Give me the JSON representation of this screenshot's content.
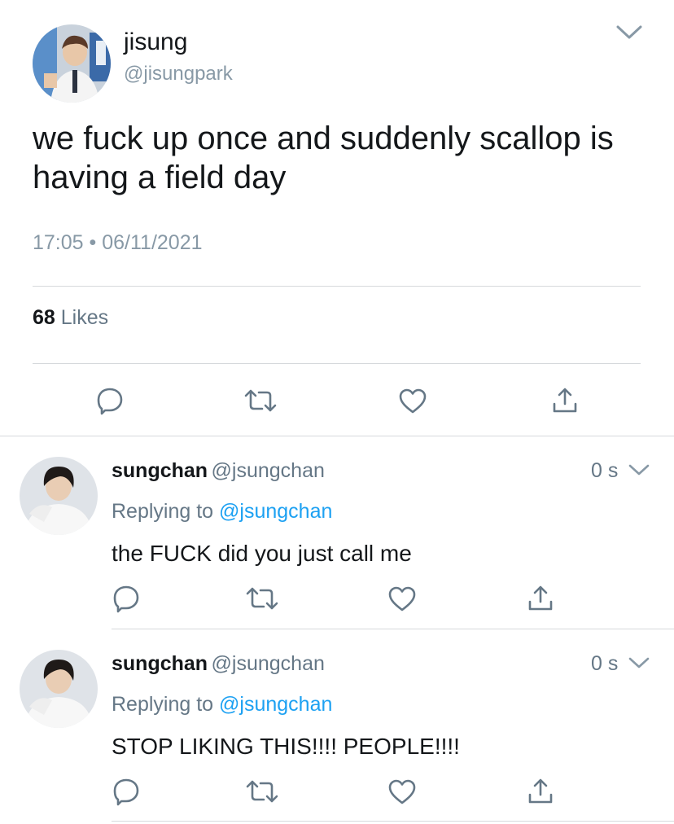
{
  "tweet": {
    "author_name": "jisung",
    "author_handle": "@jisungpark",
    "text": "we fuck up once and suddenly scallop is having a field day",
    "time": "17:05",
    "separator": "•",
    "date": "06/11/2021",
    "likes_count": "68",
    "likes_label": "Likes"
  },
  "replies": [
    {
      "name": "sungchan",
      "handle": "@jsungchan",
      "age": "0 s",
      "replying_prefix": "Replying to",
      "replying_to": "@jsungchan",
      "text": "the FUCK did you just call me"
    },
    {
      "name": "sungchan",
      "handle": "@jsungchan",
      "age": "0 s",
      "replying_prefix": "Replying to",
      "replying_to": "@jsungchan",
      "text": "STOP LIKING THIS!!!! PEOPLE!!!!"
    }
  ],
  "colors": {
    "accent": "#1da1f2",
    "icon_gray": "#657786",
    "divider": "#d6d9dc"
  },
  "icons": [
    "chevron-down-icon",
    "reply-icon",
    "retweet-icon",
    "like-icon",
    "share-icon"
  ]
}
